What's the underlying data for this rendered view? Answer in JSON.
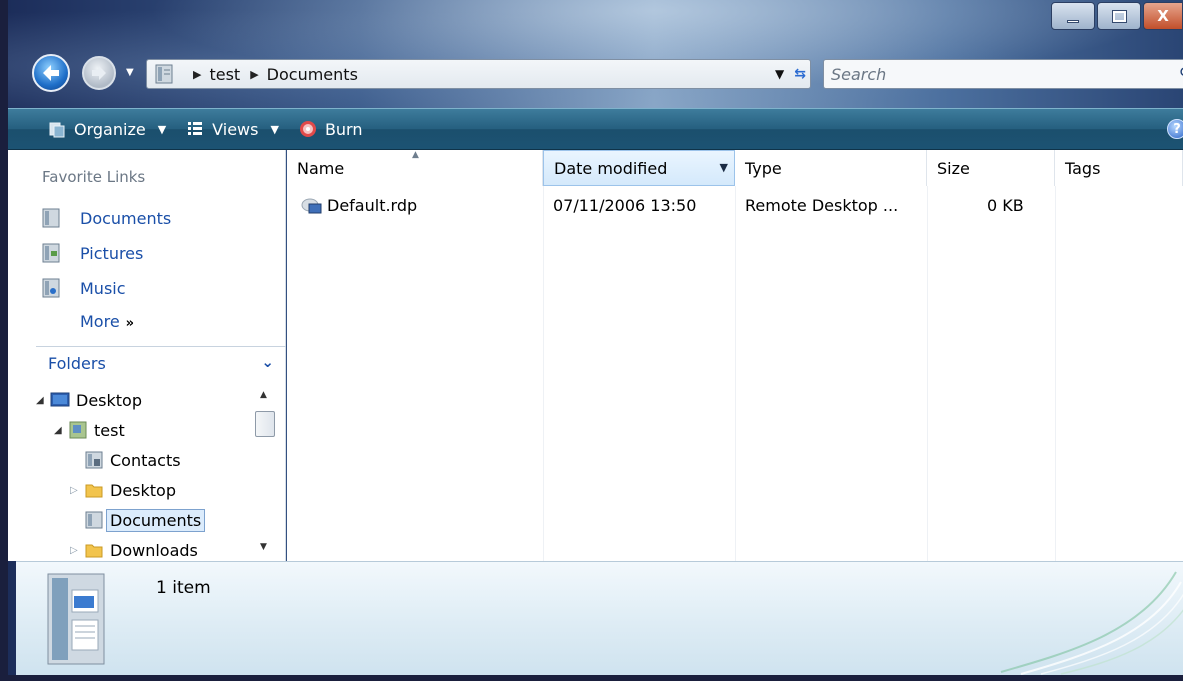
{
  "window": {
    "caption_buttons": {
      "close_glyph": "X"
    }
  },
  "address": {
    "crumbs": [
      "test",
      "Documents"
    ],
    "separator_icon": "triangle-right-icon"
  },
  "search": {
    "placeholder": "Search"
  },
  "toolbar": {
    "organize_label": "Organize",
    "views_label": "Views",
    "burn_label": "Burn",
    "help_glyph": "?"
  },
  "left_pane": {
    "favorite_links_header": "Favorite Links",
    "favorites": [
      {
        "label": "Documents",
        "icon": "documents-icon"
      },
      {
        "label": "Pictures",
        "icon": "pictures-icon"
      },
      {
        "label": "Music",
        "icon": "music-icon"
      }
    ],
    "more_label": "More",
    "more_glyph": "»",
    "folders_header": "Folders",
    "tree": [
      {
        "label": "Desktop",
        "icon": "desktop-icon",
        "expanded": true,
        "level": 0
      },
      {
        "label": "test",
        "icon": "user-folder-icon",
        "expanded": true,
        "level": 1
      },
      {
        "label": "Contacts",
        "icon": "contacts-icon",
        "level": 2
      },
      {
        "label": "Desktop",
        "icon": "folder-icon",
        "expanded": false,
        "level": 2
      },
      {
        "label": "Documents",
        "icon": "documents-icon",
        "level": 2,
        "selected": true
      },
      {
        "label": "Downloads",
        "icon": "folder-icon",
        "expanded": false,
        "level": 2
      }
    ]
  },
  "file_list": {
    "columns": [
      "Name",
      "Date modified",
      "Type",
      "Size",
      "Tags"
    ],
    "rows": [
      {
        "name": "Default.rdp",
        "date_modified": "07/11/2006 13:50",
        "type": "Remote Desktop ...",
        "size": "0 KB",
        "tags": "",
        "icon": "remote-desktop-file-icon"
      }
    ]
  },
  "details_pane": {
    "item_count": "1 item"
  },
  "colors": {
    "toolbar": "#1c5373",
    "link_blue": "#1a4fa8",
    "selection": "#dcecfc",
    "details_bg": "#dcebf4"
  }
}
